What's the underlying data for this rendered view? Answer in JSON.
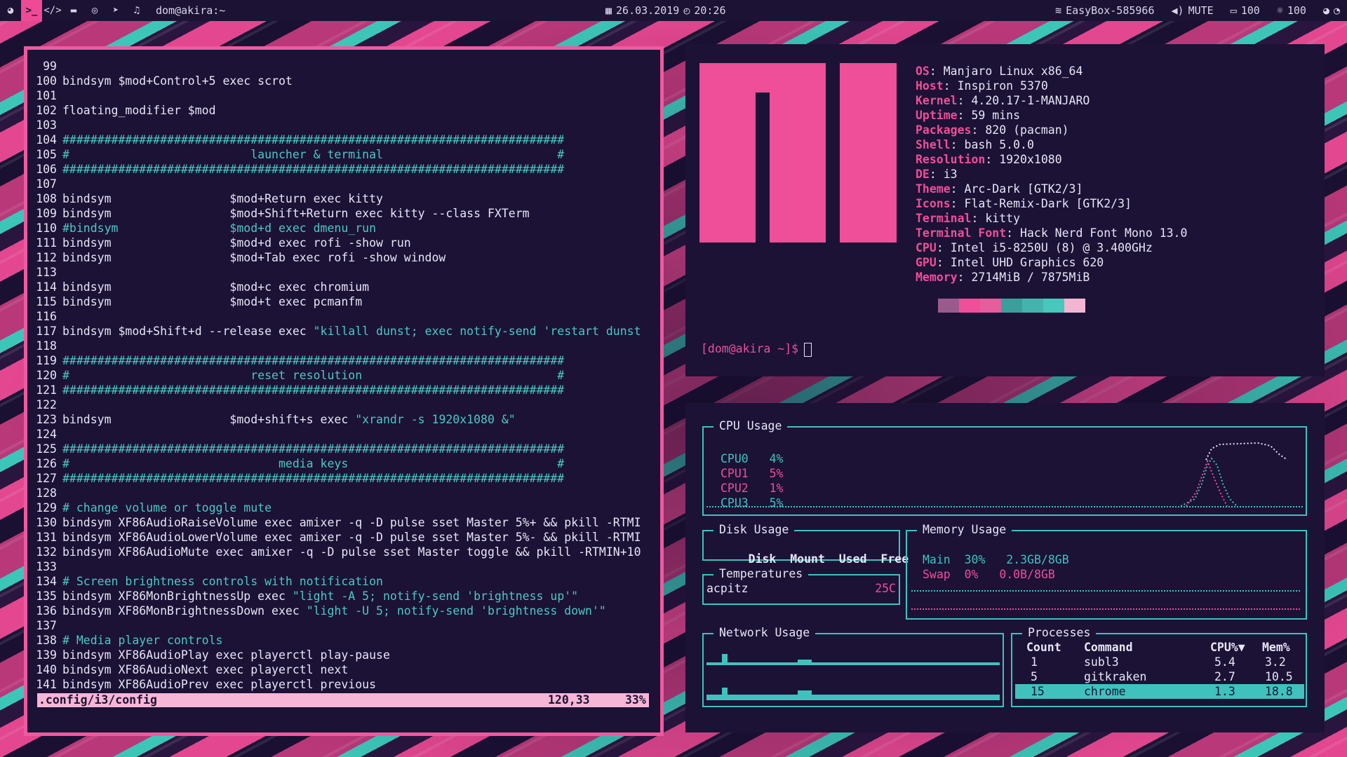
{
  "topbar": {
    "workspace_icons": [
      "chrome-icon",
      "terminal-icon",
      "code-icon",
      "folder-icon",
      "gamepad-icon",
      "telegram-icon",
      "music-icon"
    ],
    "window_title": "dom@akira:~",
    "date": "26.03.2019",
    "time": "20:26",
    "wifi": "EasyBox-585966",
    "volume": "MUTE",
    "battery": "100",
    "brightness": "100"
  },
  "editor": {
    "lines": [
      {
        "n": "99",
        "t": ""
      },
      {
        "n": "100",
        "t": "bindsym $mod+Control+5 exec scrot"
      },
      {
        "n": "101",
        "t": ""
      },
      {
        "n": "102",
        "t": "floating_modifier $mod"
      },
      {
        "n": "103",
        "t": ""
      },
      {
        "n": "104",
        "t": "########################################################################",
        "c": "hash"
      },
      {
        "n": "105",
        "t": "#                          launcher & terminal                         #",
        "c": "hash"
      },
      {
        "n": "106",
        "t": "########################################################################",
        "c": "hash"
      },
      {
        "n": "107",
        "t": ""
      },
      {
        "n": "108",
        "t": "bindsym                 $mod+Return exec kitty"
      },
      {
        "n": "109",
        "t": "bindsym                 $mod+Shift+Return exec kitty --class FXTerm"
      },
      {
        "n": "110",
        "t": "#bindsym                $mod+d exec dmenu_run",
        "c": "cm"
      },
      {
        "n": "111",
        "t": "bindsym                 $mod+d exec rofi -show run"
      },
      {
        "n": "112",
        "t": "bindsym                 $mod+Tab exec rofi -show window"
      },
      {
        "n": "113",
        "t": ""
      },
      {
        "n": "114",
        "t": "bindsym                 $mod+c exec chromium"
      },
      {
        "n": "115",
        "t": "bindsym                 $mod+t exec pcmanfm"
      },
      {
        "n": "116",
        "t": ""
      },
      {
        "n": "117",
        "t": "bindsym $mod+Shift+d --release exec ",
        "s": "\"killall dunst; exec notify-send 'restart dunst"
      },
      {
        "n": "118",
        "t": ""
      },
      {
        "n": "119",
        "t": "########################################################################",
        "c": "hash"
      },
      {
        "n": "120",
        "t": "#                          reset resolution                            #",
        "c": "hash"
      },
      {
        "n": "121",
        "t": "########################################################################",
        "c": "hash"
      },
      {
        "n": "122",
        "t": ""
      },
      {
        "n": "123",
        "t": "bindsym                 $mod+shift+s exec ",
        "s": "\"xrandr -s 1920x1080 &\""
      },
      {
        "n": "124",
        "t": ""
      },
      {
        "n": "125",
        "t": "########################################################################",
        "c": "hash"
      },
      {
        "n": "126",
        "t": "#                              media keys                              #",
        "c": "hash"
      },
      {
        "n": "127",
        "t": "########################################################################",
        "c": "hash"
      },
      {
        "n": "128",
        "t": ""
      },
      {
        "n": "129",
        "t": "# change volume or toggle mute",
        "c": "cm"
      },
      {
        "n": "130",
        "t": "bindsym XF86AudioRaiseVolume exec amixer -q -D pulse sset Master 5%+ && pkill -RTMI"
      },
      {
        "n": "131",
        "t": "bindsym XF86AudioLowerVolume exec amixer -q -D pulse sset Master 5%- && pkill -RTMI"
      },
      {
        "n": "132",
        "t": "bindsym XF86AudioMute exec amixer -q -D pulse sset Master toggle && pkill -RTMIN+10"
      },
      {
        "n": "133",
        "t": ""
      },
      {
        "n": "134",
        "t": "# Screen brightness controls with notification",
        "c": "cm"
      },
      {
        "n": "135",
        "t": "bindsym XF86MonBrightnessUp exec ",
        "s": "\"light -A 5; notify-send 'brightness up'\""
      },
      {
        "n": "136",
        "t": "bindsym XF86MonBrightnessDown exec ",
        "s": "\"light -U 5; notify-send 'brightness down'\""
      },
      {
        "n": "137",
        "t": ""
      },
      {
        "n": "138",
        "t": "# Media player controls",
        "c": "cm"
      },
      {
        "n": "139",
        "t": "bindsym XF86AudioPlay exec playerctl play-pause"
      },
      {
        "n": "140",
        "t": "bindsym XF86AudioNext exec playerctl next"
      },
      {
        "n": "141",
        "t": "bindsym XF86AudioPrev exec playerctl previous"
      }
    ],
    "status": {
      "file": ".config/i3/config",
      "pos": "120,33",
      "percent": "33%"
    }
  },
  "fetch": {
    "info": [
      {
        "k": "OS",
        "v": "Manjaro Linux x86_64"
      },
      {
        "k": "Host",
        "v": "Inspiron 5370"
      },
      {
        "k": "Kernel",
        "v": "4.20.17-1-MANJARO"
      },
      {
        "k": "Uptime",
        "v": "59 mins"
      },
      {
        "k": "Packages",
        "v": "820 (pacman)"
      },
      {
        "k": "Shell",
        "v": "bash 5.0.0"
      },
      {
        "k": "Resolution",
        "v": "1920x1080"
      },
      {
        "k": "DE",
        "v": "i3"
      },
      {
        "k": "Theme",
        "v": "Arc-Dark [GTK2/3]"
      },
      {
        "k": "Icons",
        "v": "Flat-Remix-Dark [GTK2/3]"
      },
      {
        "k": "Terminal",
        "v": "kitty"
      },
      {
        "k": "Terminal Font",
        "v": "Hack Nerd Font Mono 13.0"
      },
      {
        "k": "CPU",
        "v": "Intel i5-8250U (8) @ 3.400GHz"
      },
      {
        "k": "GPU",
        "v": "Intel UHD Graphics 620"
      },
      {
        "k": "Memory",
        "v": "2714MiB / 7875MiB"
      }
    ],
    "palette": [
      "#9b5a8c",
      "#ee4f98",
      "#e45d9c",
      "#3b9e9a",
      "#44b3ad",
      "#48c7bd",
      "#f2b6d3"
    ],
    "prompt": "[dom@akira ~]$"
  },
  "gtop": {
    "cpu_title": "CPU Usage",
    "cpus": [
      {
        "name": "CPU0",
        "pct": "4%"
      },
      {
        "name": "CPU1",
        "pct": "5%"
      },
      {
        "name": "CPU2",
        "pct": "1%"
      },
      {
        "name": "CPU3",
        "pct": "5%"
      }
    ],
    "disk_title": "Disk Usage",
    "disk_headers": [
      "Disk",
      "Mount",
      "Used",
      "Free"
    ],
    "mem_title": "Memory Usage",
    "mem_rows": [
      {
        "name": "Main",
        "pct": "30%",
        "amt": "2.3GB/8GB"
      },
      {
        "name": "Swap",
        "pct": "0%",
        "amt": "0.0B/8GB"
      }
    ],
    "temp_title": "Temperatures",
    "temp": {
      "sensor": "acpitz",
      "value": "25C"
    },
    "net_title": "Network Usage",
    "proc_title": "Processes",
    "proc_headers": [
      "Count",
      "Command",
      "CPU%▼",
      "Mem%"
    ],
    "procs": [
      {
        "count": "1",
        "cmd": "subl3",
        "cpu": "5.4",
        "mem": "3.2"
      },
      {
        "count": "5",
        "cmd": "gitkraken",
        "cpu": "2.7",
        "mem": "10.5"
      },
      {
        "count": "15",
        "cmd": "chrome",
        "cpu": "1.3",
        "mem": "18.8"
      }
    ]
  }
}
